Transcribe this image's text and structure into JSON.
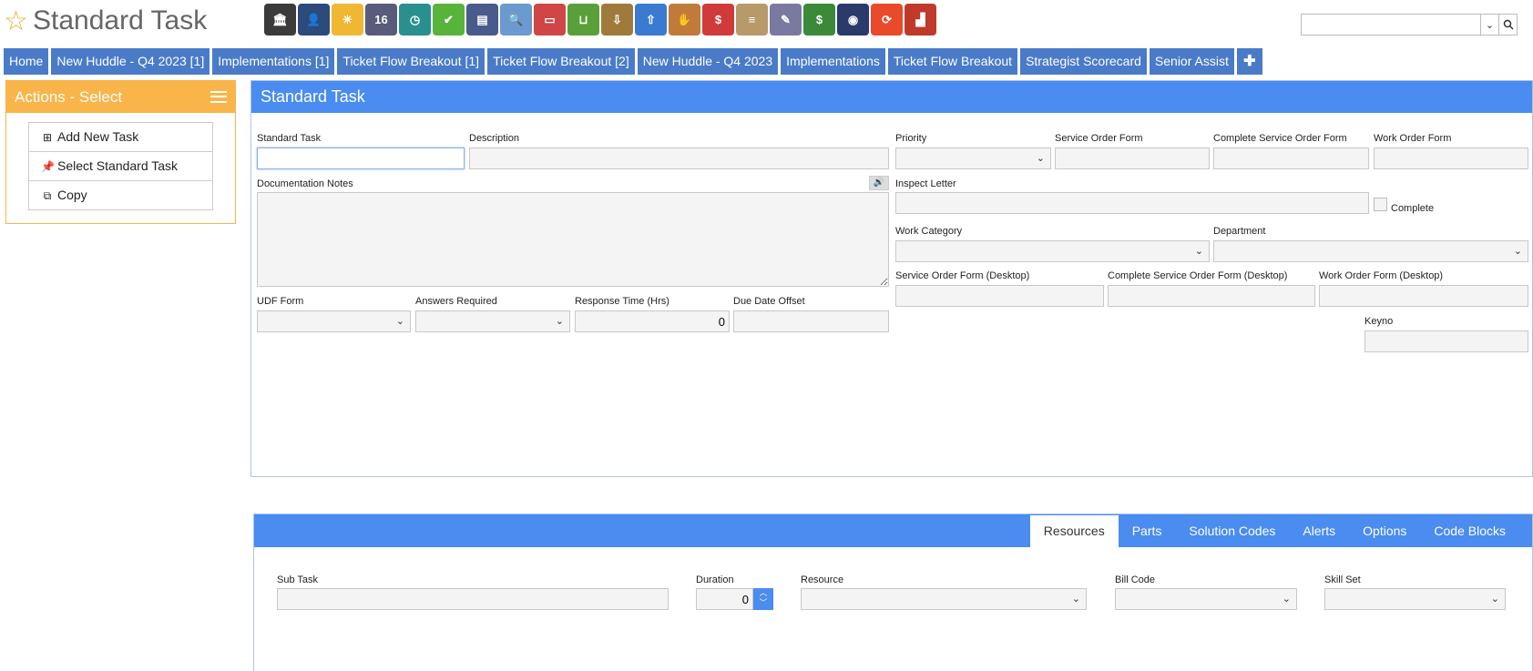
{
  "header": {
    "title": "Standard Task",
    "icons": [
      {
        "name": "bank-icon",
        "color": "#3b3b3b",
        "text": "🏛"
      },
      {
        "name": "user-icon",
        "color": "#2c4a7a",
        "text": "👤"
      },
      {
        "name": "weather-icon",
        "color": "#f0b732",
        "text": "☀"
      },
      {
        "name": "calendar-icon",
        "color": "#5a5a7a",
        "text": "16"
      },
      {
        "name": "clock-icon",
        "color": "#2a8f8f",
        "text": "◷"
      },
      {
        "name": "checkmark-icon",
        "color": "#58b33a",
        "text": "✔"
      },
      {
        "name": "keyboard-icon",
        "color": "#4a5a8a",
        "text": "▤"
      },
      {
        "name": "magnifier-icon",
        "color": "#6a9ad0",
        "text": "🔍"
      },
      {
        "name": "bus-icon",
        "color": "#d04545",
        "text": "▭"
      },
      {
        "name": "basket-icon",
        "color": "#5aa03a",
        "text": "⊔"
      },
      {
        "name": "inbox-download-icon",
        "color": "#a07a3a",
        "text": "⇩"
      },
      {
        "name": "inbox-upload-icon",
        "color": "#3a7ad0",
        "text": "⇧"
      },
      {
        "name": "hand-card-icon",
        "color": "#c07a3a",
        "text": "✋"
      },
      {
        "name": "dollar-bubble-icon",
        "color": "#d03a3a",
        "text": "$"
      },
      {
        "name": "clipboard-icon",
        "color": "#b89a6a",
        "text": "≡"
      },
      {
        "name": "eraser-icon",
        "color": "#7a7aa0",
        "text": "✎"
      },
      {
        "name": "cash-icon",
        "color": "#3a8a3a",
        "text": "$"
      },
      {
        "name": "phone-icon",
        "color": "#2a3a6a",
        "text": "◉"
      },
      {
        "name": "refresh-arrows-icon",
        "color": "#e84a2a",
        "text": "⟳"
      },
      {
        "name": "factory-icon",
        "color": "#c0392b",
        "text": "▟"
      }
    ],
    "search_placeholder": ""
  },
  "nav_tabs": [
    "Home",
    "New Huddle - Q4 2023 [1]",
    "Implementations [1]",
    "Ticket Flow Breakout [1]",
    "Ticket Flow Breakout [2]",
    "New Huddle - Q4 2023",
    "Implementations",
    "Ticket Flow Breakout",
    "Strategist Scorecard",
    "Senior Assist",
    "✚"
  ],
  "actions": {
    "title": "Actions - Select",
    "items": [
      {
        "label": "Add New Task",
        "icon": "plus-square-icon",
        "glyph": "⊞"
      },
      {
        "label": "Select Standard Task",
        "icon": "pin-icon",
        "glyph": "📌"
      },
      {
        "label": "Copy",
        "icon": "copy-icon",
        "glyph": "⧉"
      }
    ]
  },
  "form": {
    "title": "Standard Task",
    "standard_task_label": "Standard Task",
    "description_label": "Description",
    "priority_label": "Priority",
    "service_order_form_label": "Service Order Form",
    "complete_service_order_form_label": "Complete Service Order Form",
    "work_order_form_label": "Work Order Form",
    "documentation_notes_label": "Documentation Notes",
    "inspect_letter_label": "Inspect Letter",
    "complete_label": "Complete",
    "work_category_label": "Work Category",
    "department_label": "Department",
    "service_order_form_desktop_label": "Service Order Form (Desktop)",
    "complete_service_order_form_desktop_label": "Complete Service Order Form (Desktop)",
    "work_order_form_desktop_label": "Work Order Form (Desktop)",
    "udf_form_label": "UDF Form",
    "answers_required_label": "Answers Required",
    "response_time_label": "Response Time (Hrs)",
    "response_time_value": "0",
    "due_date_offset_label": "Due Date Offset",
    "keyno_label": "Keyno"
  },
  "bottom": {
    "tabs": [
      "Resources",
      "Parts",
      "Solution Codes",
      "Alerts",
      "Options",
      "Code Blocks"
    ],
    "active_tab": "Resources",
    "sub_task_label": "Sub Task",
    "duration_label": "Duration",
    "duration_value": "0",
    "resource_label": "Resource",
    "bill_code_label": "Bill Code",
    "skill_set_label": "Skill Set"
  }
}
